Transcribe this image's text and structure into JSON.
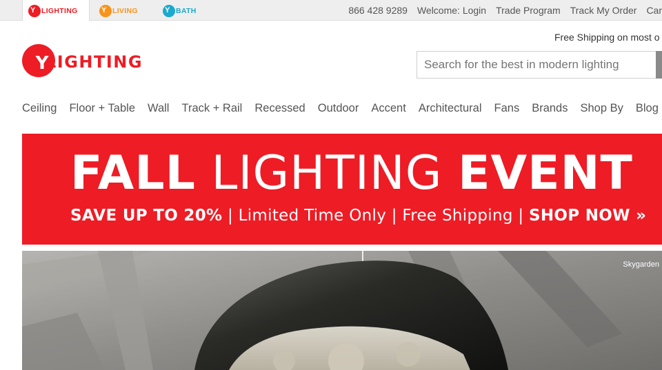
{
  "site_tabs": [
    {
      "label": "LIGHTING",
      "color": "#ee1c25"
    },
    {
      "label": "LIVING",
      "color": "#f7941d"
    },
    {
      "label": "BATH",
      "color": "#1ba9cf"
    }
  ],
  "utility": {
    "phone": "866 428 9289",
    "welcome": "Welcome: Login",
    "trade": "Trade Program",
    "track": "Track My Order",
    "cart": "Car"
  },
  "free_shipping": "Free Shipping on most o",
  "logo": {
    "text": "LIGHTING",
    "color": "#ee1c25"
  },
  "search": {
    "placeholder": "Search for the best in modern lighting"
  },
  "nav": [
    "Ceiling",
    "Floor + Table",
    "Wall",
    "Track + Rail",
    "Recessed",
    "Outdoor",
    "Accent",
    "Architectural",
    "Fans",
    "Brands",
    "Shop By",
    "Blog"
  ],
  "banner": {
    "headline_1": "FALL",
    "headline_2": " LIGHTING ",
    "headline_3": "EVENT",
    "sub_1": "SAVE UP TO 20%",
    "sub_2": " | Limited Time Only | Free Shipping | ",
    "sub_3": "SHOP NOW »",
    "color": "#ee1c25"
  },
  "hero": {
    "caption": "Skygarden"
  }
}
